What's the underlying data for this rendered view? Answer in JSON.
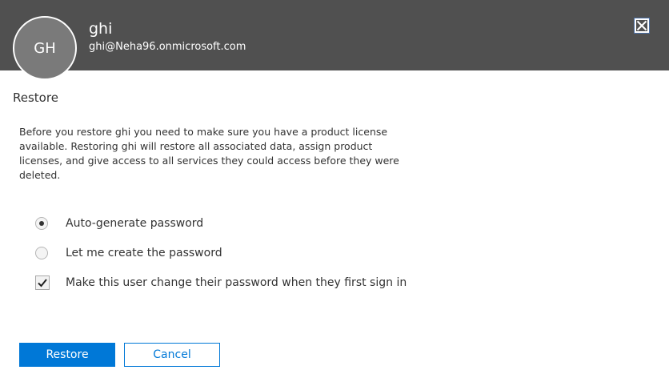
{
  "header": {
    "avatar_initials": "GH",
    "user_name": "ghi",
    "user_email": "ghi@Neha96.onmicrosoft.com",
    "close_icon": "close-icon"
  },
  "panel": {
    "title": "Restore",
    "description": "Before you restore ghi you need to make sure you have a product license available. Restoring ghi will restore all associated data, assign product licenses, and give access to all services they could access before they were deleted."
  },
  "options": {
    "auto_generate": {
      "label": "Auto-generate password",
      "selected": true
    },
    "create_password": {
      "label": "Let me create the password",
      "selected": false
    },
    "change_on_signin": {
      "label": "Make this user change their password when they first sign in",
      "checked": true
    }
  },
  "actions": {
    "restore_label": "Restore",
    "cancel_label": "Cancel"
  },
  "colors": {
    "header_bg": "#505050",
    "accent": "#0078d7"
  }
}
